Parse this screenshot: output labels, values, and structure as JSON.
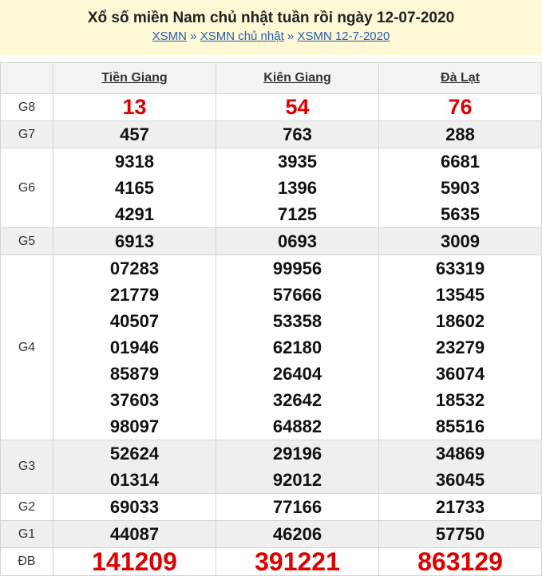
{
  "header": {
    "title": "Xổ số miền Nam chủ nhật tuần rồi ngày 12-07-2020",
    "breadcrumbs": [
      "XSMN",
      "XSMN chủ nhật",
      "XSMN 12-7-2020"
    ],
    "separator": "»"
  },
  "table": {
    "columns": [
      "Tiền Giang",
      "Kiên Giang",
      "Đà Lạt"
    ],
    "rows": [
      {
        "label": "G8",
        "values": [
          [
            "13"
          ],
          [
            "54"
          ],
          [
            "76"
          ]
        ]
      },
      {
        "label": "G7",
        "values": [
          [
            "457"
          ],
          [
            "763"
          ],
          [
            "288"
          ]
        ]
      },
      {
        "label": "G6",
        "values": [
          [
            "9318",
            "4165",
            "4291"
          ],
          [
            "3935",
            "1396",
            "7125"
          ],
          [
            "6681",
            "5903",
            "5635"
          ]
        ]
      },
      {
        "label": "G5",
        "values": [
          [
            "6913"
          ],
          [
            "0693"
          ],
          [
            "3009"
          ]
        ]
      },
      {
        "label": "G4",
        "values": [
          [
            "07283",
            "21779",
            "40507",
            "01946",
            "85879",
            "37603",
            "98097"
          ],
          [
            "99956",
            "57666",
            "53358",
            "62180",
            "26404",
            "32642",
            "64882"
          ],
          [
            "63319",
            "13545",
            "18602",
            "23279",
            "36074",
            "18532",
            "85516"
          ]
        ]
      },
      {
        "label": "G3",
        "values": [
          [
            "52624",
            "01314"
          ],
          [
            "29196",
            "92012"
          ],
          [
            "34869",
            "36045"
          ]
        ]
      },
      {
        "label": "G2",
        "values": [
          [
            "69033"
          ],
          [
            "77166"
          ],
          [
            "21733"
          ]
        ]
      },
      {
        "label": "G1",
        "values": [
          [
            "44087"
          ],
          [
            "46206"
          ],
          [
            "57750"
          ]
        ]
      },
      {
        "label": "ĐB",
        "values": [
          [
            "141209"
          ],
          [
            "391221"
          ],
          [
            "863129"
          ]
        ]
      }
    ]
  }
}
